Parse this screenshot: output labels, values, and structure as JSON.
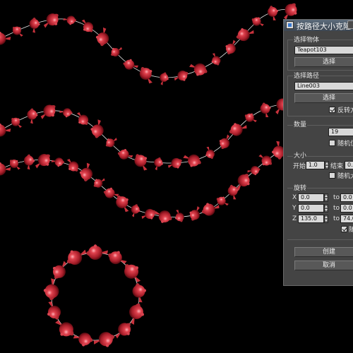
{
  "dialog": {
    "title": "按路径大小克隆",
    "select_object": {
      "group_label": "选择物体",
      "field_value": "Teapot103",
      "button_label": "选择"
    },
    "select_path": {
      "group_label": "选择路径",
      "field_value": "Line003",
      "button_label": "选择",
      "reverse_label": "反转方",
      "reverse_checked": true
    },
    "count": {
      "group_label": "数量",
      "value": "19",
      "random_pos_label": "随机位",
      "random_pos_checked": false
    },
    "size": {
      "group_label": "大小",
      "start_label": "开始",
      "start_value": "1.0",
      "end_label": "结束",
      "end_value": "0.4",
      "random_size_label": "随机大",
      "random_size_checked": false
    },
    "rotation": {
      "group_label": "旋转",
      "x_label": "X",
      "x_from": "0.0",
      "x_to_label": "to",
      "x_to": "0.0",
      "y_label": "Y",
      "y_from": "0.0",
      "y_to_label": "to",
      "y_to": "0.0",
      "z_label": "Z",
      "z_from": "135.0",
      "z_to_label": "to",
      "z_to": "74.0",
      "random_label": "随",
      "random_checked": true
    },
    "create_label": "创建",
    "cancel_label": "取消"
  },
  "viewport": {
    "background": "#000000",
    "object_color": "#c8323c",
    "path_color": "#e8e8e8"
  }
}
